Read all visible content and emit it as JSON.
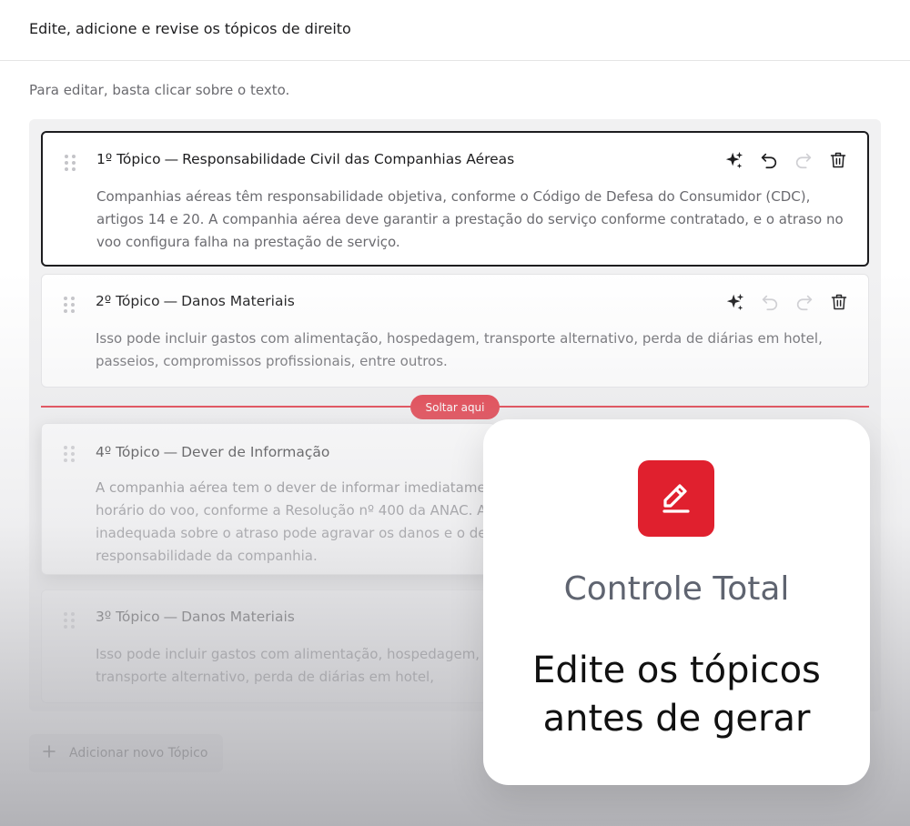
{
  "header": {
    "title": "Edite, adicione e revise os tópicos de direito"
  },
  "instruction": "Para editar, basta clicar sobre o texto.",
  "topics": [
    {
      "number": "1º Tópico",
      "separator": "—",
      "title": "Responsabilidade Civil das Companhias Aéreas",
      "body": "Companhias aéreas têm responsabilidade objetiva, conforme o Código de Defesa do Consumidor (CDC), artigos 14 e 20. A companhia aérea deve garantir a prestação do serviço conforme contratado, e o atraso no voo configura falha na prestação de serviço.",
      "undo_enabled": true,
      "redo_enabled": false
    },
    {
      "number": "2º Tópico",
      "separator": "—",
      "title": "Danos Materiais",
      "body": "Isso pode incluir gastos com alimentação, hospedagem, transporte alternativo, perda de diárias em hotel, passeios, compromissos profissionais, entre outros.",
      "undo_enabled": false,
      "redo_enabled": false
    },
    {
      "number": "4º Tópico",
      "separator": "—",
      "title": "Dever de Informação",
      "body": "A companhia aérea tem o dever de informar imediatame horário do voo, conforme a Resolução nº 400 da ANAC. A inadequada sobre o atraso pode agravar os danos e o de responsabilidade da companhia."
    },
    {
      "number": "3º Tópico",
      "separator": "—",
      "title": "Danos Materiais",
      "body": "Isso pode incluir gastos com alimentação, hospedagem, transporte alternativo, perda de diárias em hotel, passeios, compromissos profissionais, entre outros."
    }
  ],
  "drop_zone": {
    "label": "Soltar aqui"
  },
  "add_button": {
    "label": "Adicionar novo Tópico",
    "icon": "plus-icon"
  },
  "promo": {
    "icon": "edit-pencil-icon",
    "kicker": "Controle Total",
    "headline_line1": "Edite os tópicos",
    "headline_line2": "antes de gerar"
  },
  "colors": {
    "accent": "#e0202e",
    "text": "#1d1d1f",
    "muted": "#6b6b70"
  }
}
